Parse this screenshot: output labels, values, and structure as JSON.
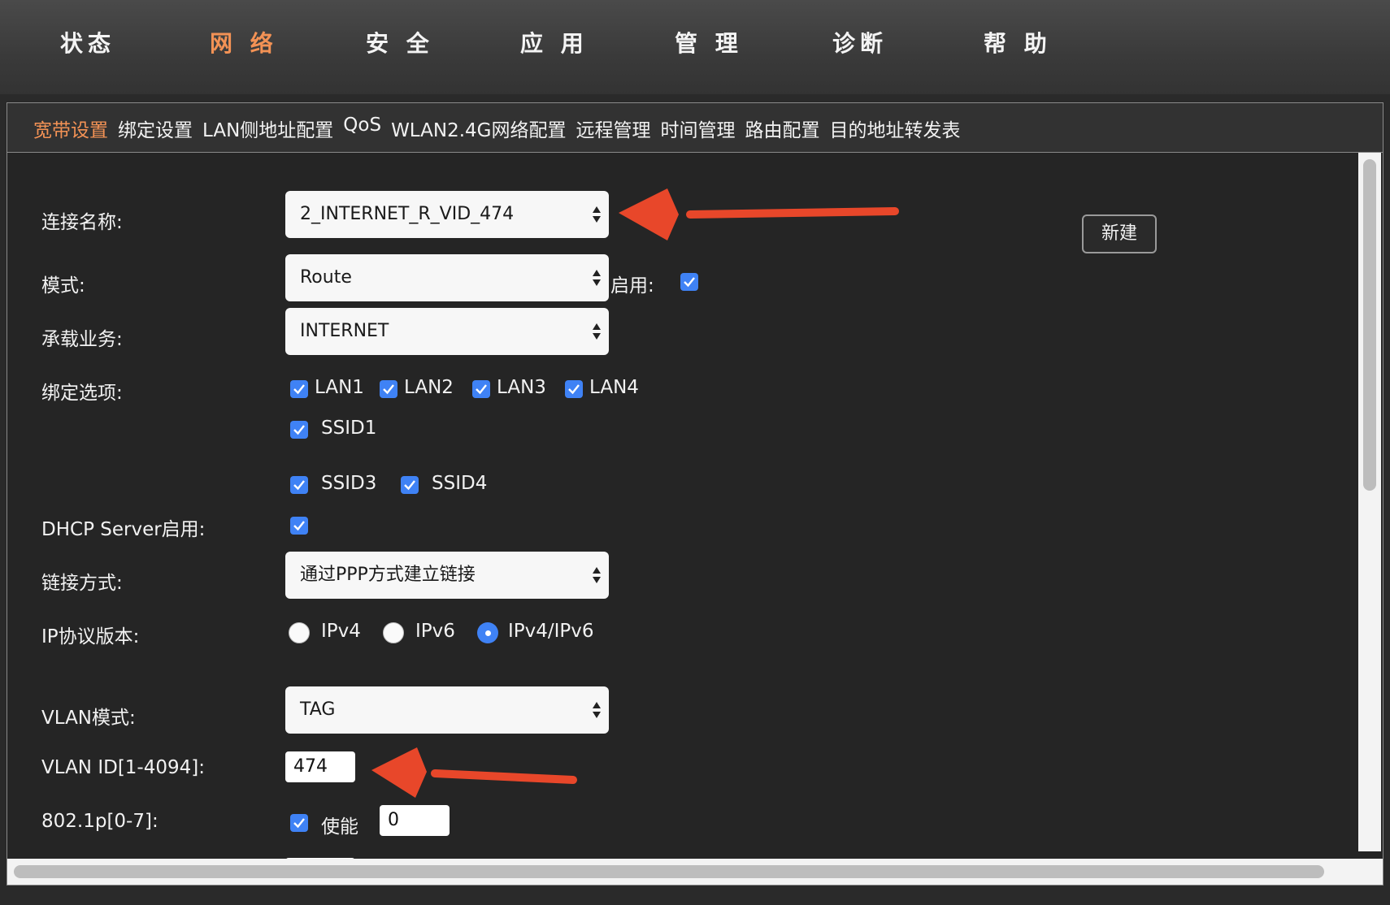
{
  "topnav": {
    "items": [
      "状态",
      "网 络",
      "安 全",
      "应 用",
      "管 理",
      "诊断",
      "帮 助"
    ],
    "active_index": 1
  },
  "subnav": {
    "items": [
      "宽带设置",
      "绑定设置",
      "LAN侧地址配置",
      "QoS",
      "WLAN2.4G网络配置",
      "远程管理",
      "时间管理",
      "路由配置",
      "目的地址转发表"
    ],
    "active_index": 0
  },
  "form": {
    "connection_name": {
      "label": "连接名称:",
      "value": "2_INTERNET_R_VID_474"
    },
    "new_button": "新建",
    "mode": {
      "label": "模式:",
      "value": "Route",
      "enable_label": "启用:",
      "enabled": true
    },
    "service": {
      "label": "承载业务:",
      "value": "INTERNET"
    },
    "binding": {
      "label": "绑定选项:",
      "options": [
        {
          "name": "LAN1",
          "checked": true
        },
        {
          "name": "LAN2",
          "checked": true
        },
        {
          "name": "LAN3",
          "checked": true
        },
        {
          "name": "LAN4",
          "checked": true
        },
        {
          "name": "SSID1",
          "checked": true
        },
        {
          "name": "SSID3",
          "checked": true
        },
        {
          "name": "SSID4",
          "checked": true
        }
      ]
    },
    "dhcp": {
      "label": "DHCP Server启用:",
      "checked": true
    },
    "link_mode": {
      "label": "链接方式:",
      "value": "通过PPP方式建立链接"
    },
    "ip_version": {
      "label": "IP协议版本:",
      "options": [
        "IPv4",
        "IPv6",
        "IPv4/IPv6"
      ],
      "selected": "IPv4/IPv6"
    },
    "vlan_mode": {
      "label": "VLAN模式:",
      "value": "TAG"
    },
    "vlan_id": {
      "label": "VLAN ID[1-4094]:",
      "value": "474"
    },
    "dot1p": {
      "label": "802.1p[0-7]:",
      "enable_label": "使能",
      "enabled": true,
      "value": "0"
    }
  },
  "colors": {
    "accent": "#f39255",
    "checkbox": "#3f82f5",
    "annotation_arrow": "#e8472a"
  }
}
